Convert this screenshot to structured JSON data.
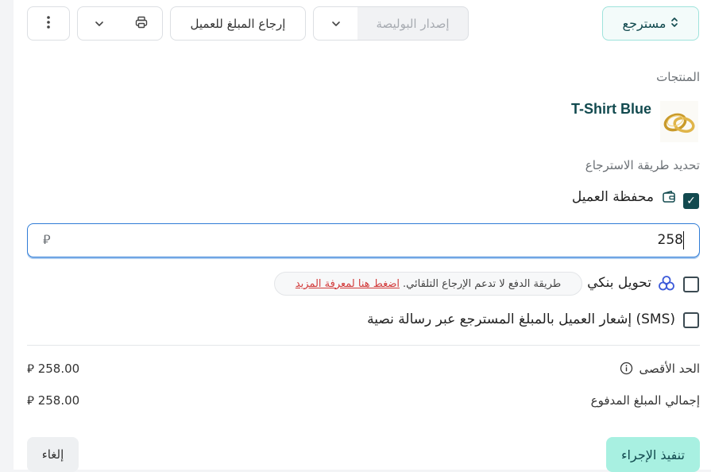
{
  "header": {
    "status_label": "مسترجع",
    "issue_policy_label": "إصدار البوليصة",
    "refund_customer_label": "إرجاع المبلغ للعميل"
  },
  "products": {
    "section_title": "المنتجات",
    "items": [
      {
        "name": "T-Shirt Blue"
      }
    ]
  },
  "refund_method": {
    "section_title": "تحديد طريقة الاسترجاع",
    "wallet": {
      "label": "محفظة العميل",
      "checked": true,
      "amount_value": "258",
      "currency": "⃁"
    },
    "bank_transfer": {
      "label": "تحويل بنكي",
      "checked": false,
      "note": "طريقة الدفع لا تدعم الإرجاع التلقائي.",
      "note_link": "اضغط هنا لمعرفة المزيد"
    },
    "sms_notify": {
      "label": "إشعار العميل بالمبلغ المسترجع عبر رسالة نصية (SMS)",
      "checked": false
    }
  },
  "summary": {
    "max_label": "الحد الأقصى",
    "max_value": "258.00",
    "paid_label": "إجمالي المبلغ المدفوع",
    "paid_value": "258.00",
    "currency": "⃁"
  },
  "footer": {
    "execute_label": "تنفيذ الإجراء",
    "cancel_label": "إلغاء"
  },
  "colors": {
    "brand_dark": "#124a4f",
    "accent_mint": "#a8f0e1",
    "focus_blue": "#2f7cd6",
    "link_red": "#d23b3b"
  },
  "icons": {
    "status": "chevron-up-down-icon",
    "dropdown": "chevron-down-icon",
    "print": "printer-icon",
    "more": "more-vertical-icon",
    "wallet": "wallet-icon",
    "bank": "bank-transfer-icon",
    "info": "info-icon"
  }
}
